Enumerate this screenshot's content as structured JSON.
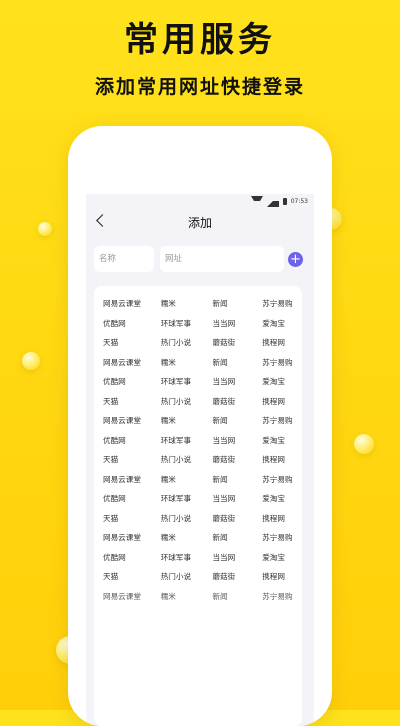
{
  "promo": {
    "title": "常用服务",
    "subtitle": "添加常用网址快捷登录"
  },
  "status_bar": {
    "time": "07:53"
  },
  "nav": {
    "title": "添加"
  },
  "form": {
    "name_placeholder": "名称",
    "url_placeholder": "网址",
    "add_label": "+"
  },
  "sites": [
    [
      "网易云课堂",
      "糯米",
      "新闻",
      "苏宁易购"
    ],
    [
      "优酷网",
      "环球军事",
      "当当网",
      "爱淘宝"
    ],
    [
      "天猫",
      "热门小说",
      "蘑菇街",
      "携程网"
    ],
    [
      "网易云课堂",
      "糯米",
      "新闻",
      "苏宁易购"
    ],
    [
      "优酷网",
      "环球军事",
      "当当网",
      "爱淘宝"
    ],
    [
      "天猫",
      "热门小说",
      "蘑菇街",
      "携程网"
    ],
    [
      "网易云课堂",
      "糯米",
      "新闻",
      "苏宁易购"
    ],
    [
      "优酷网",
      "环球军事",
      "当当网",
      "爱淘宝"
    ],
    [
      "天猫",
      "热门小说",
      "蘑菇街",
      "携程网"
    ],
    [
      "网易云课堂",
      "糯米",
      "新闻",
      "苏宁易购"
    ],
    [
      "优酷网",
      "环球军事",
      "当当网",
      "爱淘宝"
    ],
    [
      "天猫",
      "热门小说",
      "蘑菇街",
      "携程网"
    ],
    [
      "网易云课堂",
      "糯米",
      "新闻",
      "苏宁易购"
    ],
    [
      "优酷网",
      "环球军事",
      "当当网",
      "爱淘宝"
    ],
    [
      "天猫",
      "热门小说",
      "蘑菇街",
      "携程网"
    ],
    [
      "网易云课堂",
      "糯米",
      "新闻",
      "苏宁易购"
    ]
  ],
  "colors": {
    "background": "#ffd912",
    "accent": "#6d63e8"
  }
}
